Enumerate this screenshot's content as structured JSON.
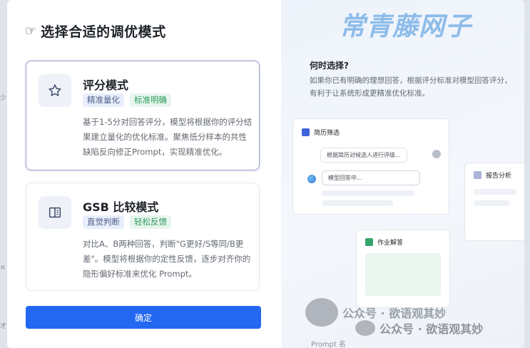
{
  "dialog": {
    "title_icon": "pointing-hand-icon",
    "title": "选择合适的调优模式",
    "modes": [
      {
        "icon": "star-icon",
        "title": "评分模式",
        "tags": [
          "精准量化",
          "标准明确"
        ],
        "description": "基于1-5分对回答评分，模型将根据你的评分结果建立量化的优化标准。聚焦低分样本的共性缺陷反向修正Prompt，实现精准优化。",
        "selected": true
      },
      {
        "icon": "compare-book-icon",
        "title": "GSB 比较模式",
        "tags": [
          "直觉判断",
          "轻松反馈"
        ],
        "description": "对比A、B两种回答，判断\"G更好/S等同/B更差\"。模型将根据你的定性反馈，逐步对齐你的隐形偏好标准来优化 Prompt。",
        "selected": false
      }
    ],
    "confirm_label": "确定"
  },
  "side_panel": {
    "watermark": "常青藤网子",
    "heading": "何时选择?",
    "description": "如果你已有明确的理想回答，根据评分标准对模型回答评分，有利于让系统形成更精准优化标准。",
    "cards": {
      "resume": {
        "title": "简历筛选",
        "user_msg": "根据简历对候选人进行评级...",
        "bot_msg": "模型回答中..."
      },
      "report": {
        "title": "报告分析"
      },
      "homework": {
        "title": "作业解答"
      }
    },
    "bottom_fragment": "Prompt 名"
  },
  "watermark_footer": {
    "line1": "公众号 · 欲语观其妙",
    "line2": "公众号 · 欲语观其妙"
  },
  "colors": {
    "accent": "#2468f2",
    "tag_green": "#2f9a5d",
    "tag_blue": "#4b5f86",
    "watermark": "#7db3e6"
  }
}
